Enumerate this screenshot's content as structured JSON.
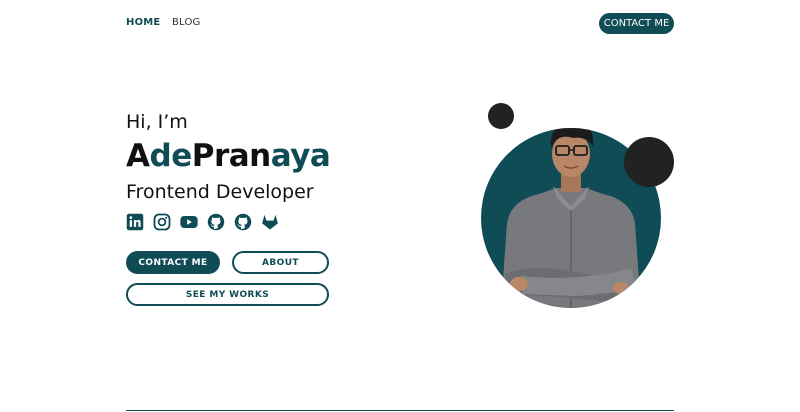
{
  "nav": {
    "links": [
      {
        "label": "HOME",
        "active": true
      },
      {
        "label": "BLOG",
        "active": false
      }
    ],
    "cta_label": "CONTACT ME"
  },
  "hero": {
    "greeting": "Hi, I’m",
    "name_part1": "A",
    "name_part2": "de",
    "name_part3": "Pran",
    "name_part4": "aya",
    "role": "Frontend Developer",
    "socials": [
      "linkedin-icon",
      "instagram-icon",
      "youtube-icon",
      "github-icon",
      "github-icon",
      "gitlab-icon"
    ],
    "buttons": {
      "contact": "CONTACT ME",
      "about": "ABOUT",
      "works": "SEE MY WORKS"
    }
  },
  "colors": {
    "accent": "#0f4c55",
    "dark": "#222222",
    "background": "#ffffff"
  }
}
